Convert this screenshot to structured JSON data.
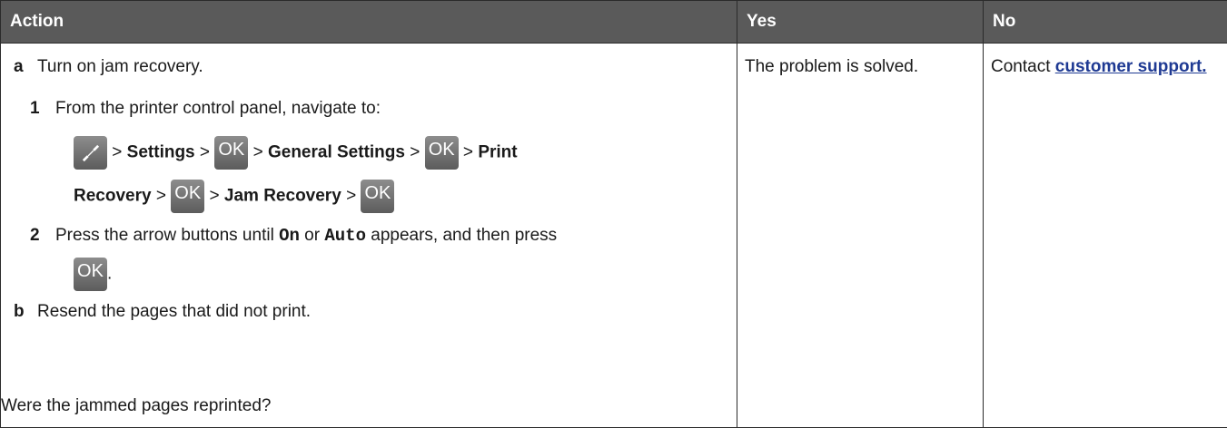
{
  "headers": {
    "action": "Action",
    "yes": "Yes",
    "no": "No"
  },
  "steps": {
    "a": {
      "letter": "a",
      "text": "Turn on jam recovery.",
      "sub1": {
        "num": "1",
        "text": "From the printer control panel, navigate to:",
        "path": {
          "settings": "Settings",
          "general_settings": "General Settings",
          "print_recovery_1": "Print",
          "print_recovery_2": "Recovery",
          "jam_recovery": "Jam Recovery",
          "sep": ">"
        }
      },
      "sub2": {
        "num": "2",
        "text_before": "Press the arrow buttons until",
        "on": "On",
        "or": "or",
        "auto": "Auto",
        "text_after": "appears, and then press",
        "period": "."
      }
    },
    "b": {
      "letter": "b",
      "text": "Resend the pages that did not print."
    },
    "question": "Were the jammed pages reprinted?"
  },
  "ok_label": "OK",
  "icons": {
    "settings": "wrench-icon",
    "ok": "ok-button-icon"
  },
  "yes_cell": "The problem is solved.",
  "no_cell": {
    "prefix": "Contact",
    "link": "customer support."
  },
  "colors": {
    "header_bg": "#5a5a5a",
    "link": "#1f3a93"
  }
}
